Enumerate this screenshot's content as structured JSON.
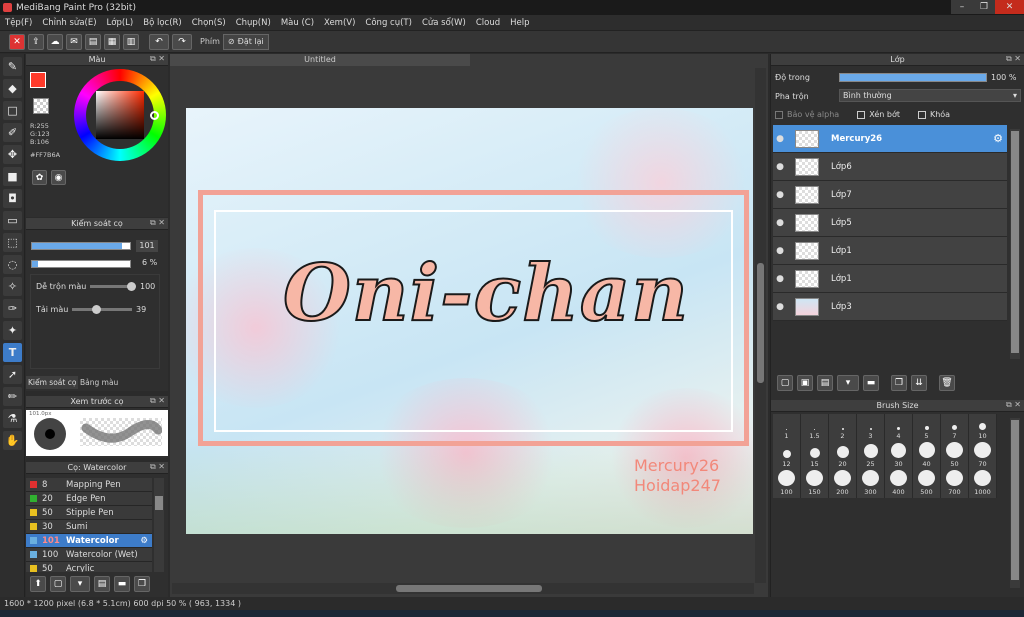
{
  "app": {
    "title": "MediBang Paint Pro (32bit)"
  },
  "menu": [
    "Tệp(F)",
    "Chỉnh sửa(E)",
    "Lớp(L)",
    "Bộ lọc(R)",
    "Chọn(S)",
    "Chụp(N)",
    "Màu (C)",
    "Xem(V)",
    "Công cụ(T)",
    "Cửa sổ(W)",
    "Cloud",
    "Help"
  ],
  "toolbar": {
    "key_label": "Phím",
    "reset_label": "Đặt lại"
  },
  "color_panel": {
    "title": "Màu",
    "r": "R:255",
    "g": "G:123",
    "b": "B:106",
    "hex": "#FF7B6A",
    "main_color": "#ff3a2a",
    "accent": "#ff7b6a"
  },
  "brush_control": {
    "title": "Kiểm soát cọ",
    "size": "101",
    "opacity": "6 %",
    "blend_label": "Dễ trộn màu",
    "blend_value": "100",
    "ink_label": "Tải màu",
    "ink_value": "39",
    "tab1": "Kiểm soát cọ",
    "tab2": "Bảng màu"
  },
  "preview": {
    "title": "Xem trước cọ",
    "size_label": "101.0px"
  },
  "brushes": {
    "title": "Cọ: Watercolor",
    "items": [
      {
        "num": "8",
        "name": "Mapping Pen",
        "color": "#e03030"
      },
      {
        "num": "20",
        "name": "Edge Pen",
        "color": "#30b030"
      },
      {
        "num": "50",
        "name": "Stipple Pen",
        "color": "#e8c020"
      },
      {
        "num": "30",
        "name": "Sumi",
        "color": "#e8c020"
      },
      {
        "num": "101",
        "name": "Watercolor",
        "color": "#6ab0e0",
        "selected": true
      },
      {
        "num": "100",
        "name": "Watercolor (Wet)",
        "color": "#6ab0e0"
      },
      {
        "num": "50",
        "name": "Acrylic",
        "color": "#e8c020"
      }
    ]
  },
  "document": {
    "tab": "Untitled",
    "art_title": "Oni-chan",
    "watermark1": "Mercury26",
    "watermark2": "Hoidap247"
  },
  "layers": {
    "title": "Lớp",
    "opacity_label": "Độ trong",
    "opacity_value": "100 %",
    "opacity_fraction": 1.0,
    "blend_label": "Pha trộn",
    "blend_value": "Bình thường",
    "protect_alpha": "Bảo vệ alpha",
    "clip": "Xén bớt",
    "lock": "Khóa",
    "items": [
      {
        "name": "Mercury26",
        "selected": true
      },
      {
        "name": "Lớp6"
      },
      {
        "name": "Lớp7"
      },
      {
        "name": "Lớp5"
      },
      {
        "name": "Lớp1"
      },
      {
        "name": "Lớp1"
      },
      {
        "name": "Lớp3"
      }
    ]
  },
  "brush_size": {
    "title": "Brush Size",
    "sizes": [
      "1",
      "1.5",
      "2",
      "3",
      "4",
      "5",
      "7",
      "10",
      "12",
      "15",
      "20",
      "25",
      "30",
      "40",
      "50",
      "70",
      "100",
      "150",
      "200",
      "300",
      "400",
      "500",
      "700",
      "1000"
    ]
  },
  "status": {
    "text": "1600 * 1200 pixel  (6.8 * 5.1cm)  600 dpi  50 %  ( 963, 1334 )"
  }
}
